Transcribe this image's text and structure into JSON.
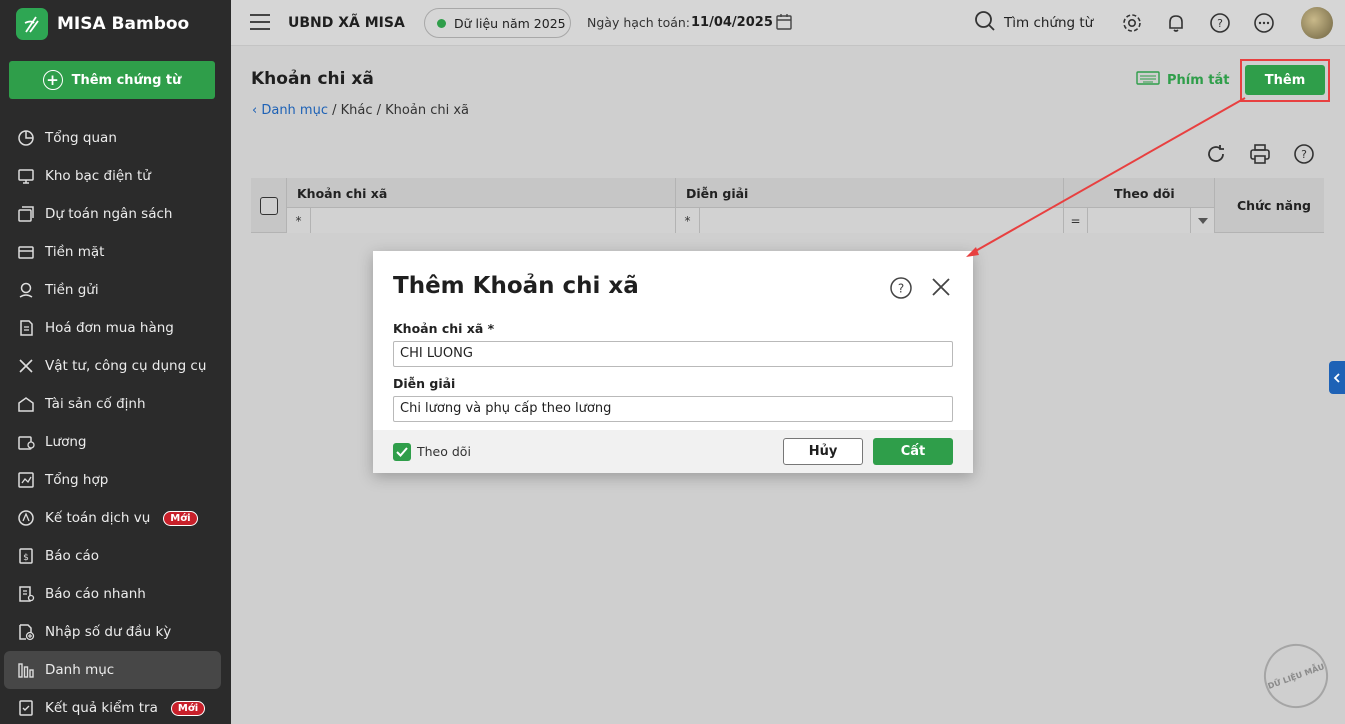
{
  "sidebar": {
    "brand": "MISA Bamboo",
    "add_voucher": "Thêm chứng từ",
    "items": [
      {
        "label": "Tổng quan",
        "icon": "pie-chart-icon"
      },
      {
        "label": "Kho bạc điện tử",
        "icon": "monitor-icon"
      },
      {
        "label": "Dự toán ngân sách",
        "icon": "budget-icon"
      },
      {
        "label": "Tiền mặt",
        "icon": "cash-icon"
      },
      {
        "label": "Tiền gửi",
        "icon": "deposit-icon"
      },
      {
        "label": "Hoá đơn mua hàng",
        "icon": "invoice-icon"
      },
      {
        "label": "Vật tư, công cụ dụng cụ",
        "icon": "tools-icon"
      },
      {
        "label": "Tài sản cố định",
        "icon": "building-icon"
      },
      {
        "label": "Lương",
        "icon": "salary-icon"
      },
      {
        "label": "Tổng hợp",
        "icon": "summary-icon"
      },
      {
        "label": "Kế toán dịch vụ",
        "icon": "service-icon",
        "badge": "Mới"
      },
      {
        "label": "Báo cáo",
        "icon": "report-icon"
      },
      {
        "label": "Báo cáo nhanh",
        "icon": "quick-report-icon"
      },
      {
        "label": "Nhập số dư đầu kỳ",
        "icon": "opening-balance-icon"
      },
      {
        "label": "Danh mục",
        "icon": "category-icon",
        "active": true
      },
      {
        "label": "Kết quả kiểm tra",
        "icon": "check-result-icon",
        "badge": "Mới"
      }
    ]
  },
  "topbar": {
    "org_name": "UBND XÃ MISA",
    "year_label": "Dữ liệu năm 2025",
    "posting_label": "Ngày hạch toán:",
    "posting_date": "11/04/2025",
    "search_label": "Tìm chứng từ"
  },
  "page": {
    "title": "Khoản chi xã",
    "breadcrumb_link": "Danh mục",
    "breadcrumb_rest": " / Khác / Khoản chi xã",
    "shortcut_label": "Phím tắt",
    "add_label": "Thêm"
  },
  "grid": {
    "columns": [
      "Khoản chi xã",
      "Diễn giải",
      "Theo dõi",
      "Chức năng"
    ],
    "filter_ops": [
      "*",
      "*",
      "="
    ]
  },
  "dialog": {
    "title": "Thêm Khoản chi xã",
    "field1_label": "Khoản chi xã *",
    "field1_value": "CHI LUONG",
    "field2_label": "Diễn giải",
    "field2_value": "Chi lương và phụ cấp theo lương",
    "follow_label": "Theo dõi",
    "follow_checked": true,
    "cancel_label": "Hủy",
    "save_label": "Cất"
  },
  "watermark": "DỮ LIỆU MẪU",
  "colors": {
    "accent": "#2f9e4a",
    "sidebar_bg": "#2b2b2b",
    "link": "#1e62b6",
    "highlight": "#e84040",
    "badge": "#c8202a"
  }
}
